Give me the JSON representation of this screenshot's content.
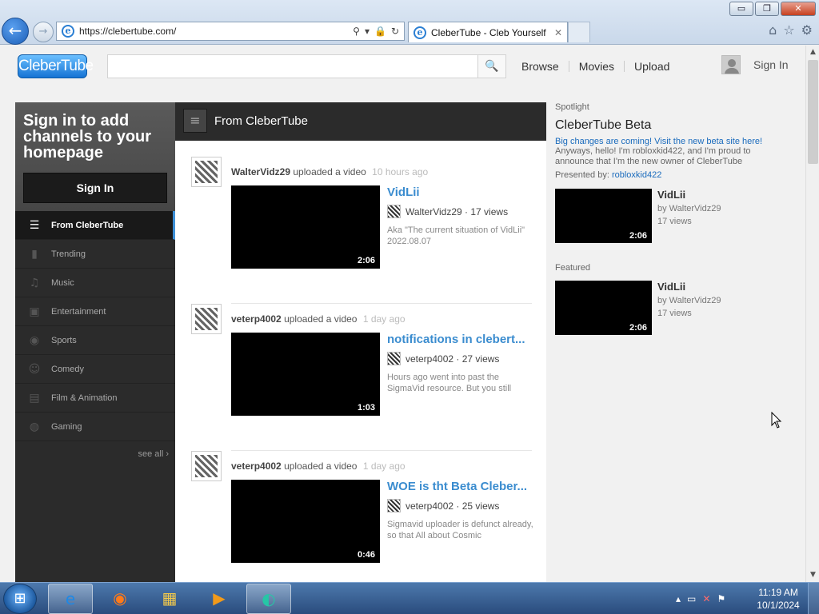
{
  "browser": {
    "url": "https://clebertube.com/",
    "tab_title": "CleberTube - Cleb Yourself",
    "min_glyph": "▭",
    "restore_glyph": "❐",
    "close_glyph": "✕",
    "back_glyph": "←",
    "fwd_glyph": "→",
    "ie_glyph": "e",
    "search_glyph": "⚲",
    "dropdown_glyph": "▾",
    "lock_glyph": "🔒",
    "refresh_glyph": "↻",
    "tab_close_glyph": "✕",
    "home_glyph": "⌂",
    "star_glyph": "☆",
    "gear_glyph": "⚙"
  },
  "masthead": {
    "logo": "CleberTube",
    "search_placeholder": "",
    "search_glyph": "🔍",
    "nav": [
      "Browse",
      "Movies",
      "Upload"
    ],
    "sign_in": "Sign In"
  },
  "guide": {
    "heading": "Sign in to add channels to your homepage",
    "sign_in_button": "Sign In",
    "items": [
      {
        "label": "From CleberTube",
        "icon": "list-icon",
        "glyph": "☰",
        "active": true
      },
      {
        "label": "Trending",
        "icon": "bar-chart-icon",
        "glyph": "▮"
      },
      {
        "label": "Music",
        "icon": "headphones-icon",
        "glyph": "♫"
      },
      {
        "label": "Entertainment",
        "icon": "tv-icon",
        "glyph": "▣"
      },
      {
        "label": "Sports",
        "icon": "sports-icon",
        "glyph": "◉"
      },
      {
        "label": "Comedy",
        "icon": "mask-icon",
        "glyph": "☺"
      },
      {
        "label": "Film & Animation",
        "icon": "film-icon",
        "glyph": "▤"
      },
      {
        "label": "Gaming",
        "icon": "gamepad-icon",
        "glyph": "◍"
      }
    ],
    "see_all": "see all ›"
  },
  "feed": {
    "title": "From CleberTube",
    "menu_glyph": "≡",
    "items": [
      {
        "user": "WalterVidz29",
        "action": "uploaded a video",
        "time": "10 hours ago",
        "title": "VidLii",
        "channel": "WalterVidz29",
        "views": "· 17 views",
        "desc": "Aka \"The current situation of VidLii\" 2022.08.07",
        "duration": "2:06"
      },
      {
        "user": "veterp4002",
        "action": "uploaded a video",
        "time": "1 day ago",
        "title": "notifications in clebert...",
        "channel": "veterp4002",
        "views": "· 27 views",
        "desc": "Hours ago went into past the SigmaVid resource. But you still",
        "duration": "1:03"
      },
      {
        "user": "veterp4002",
        "action": "uploaded a video",
        "time": "1 day ago",
        "title": "WOE is tht Beta Cleber...",
        "channel": "veterp4002",
        "views": "· 25 views",
        "desc": "Sigmavid uploader is defunct already, so that All about Cosmic",
        "duration": "0:46"
      }
    ]
  },
  "spotlight": {
    "label": "Spotlight",
    "title": "CleberTube Beta",
    "link": "Big changes are coming! Visit the new beta site here!",
    "text": "Anyways, hello! I'm robloxkid422, and I'm proud to announce that I'm the new owner of CleberTube",
    "presented_label": "Presented by: ",
    "presented_user": "robloxkid422",
    "video": {
      "title": "VidLii",
      "by": "by WalterVidz29",
      "views": "17 views",
      "duration": "2:06"
    }
  },
  "featured": {
    "label": "Featured",
    "video": {
      "title": "VidLii",
      "by": "by WalterVidz29",
      "views": "17 views",
      "duration": "2:06"
    }
  },
  "taskbar": {
    "start_glyph": "⊞",
    "apps": [
      {
        "name": "internet-explorer",
        "glyph": "e",
        "active": true
      },
      {
        "name": "firefox",
        "glyph": "◉"
      },
      {
        "name": "file-explorer",
        "glyph": "▦"
      },
      {
        "name": "media-player",
        "glyph": "▶"
      },
      {
        "name": "app-five",
        "glyph": "◐",
        "active": true
      }
    ],
    "tray_glyphs": [
      "▴",
      "▭",
      "✕",
      "⚑"
    ],
    "time": "11:19 AM",
    "date": "10/1/2024"
  },
  "scroll": {
    "up": "▲",
    "down": "▼"
  }
}
